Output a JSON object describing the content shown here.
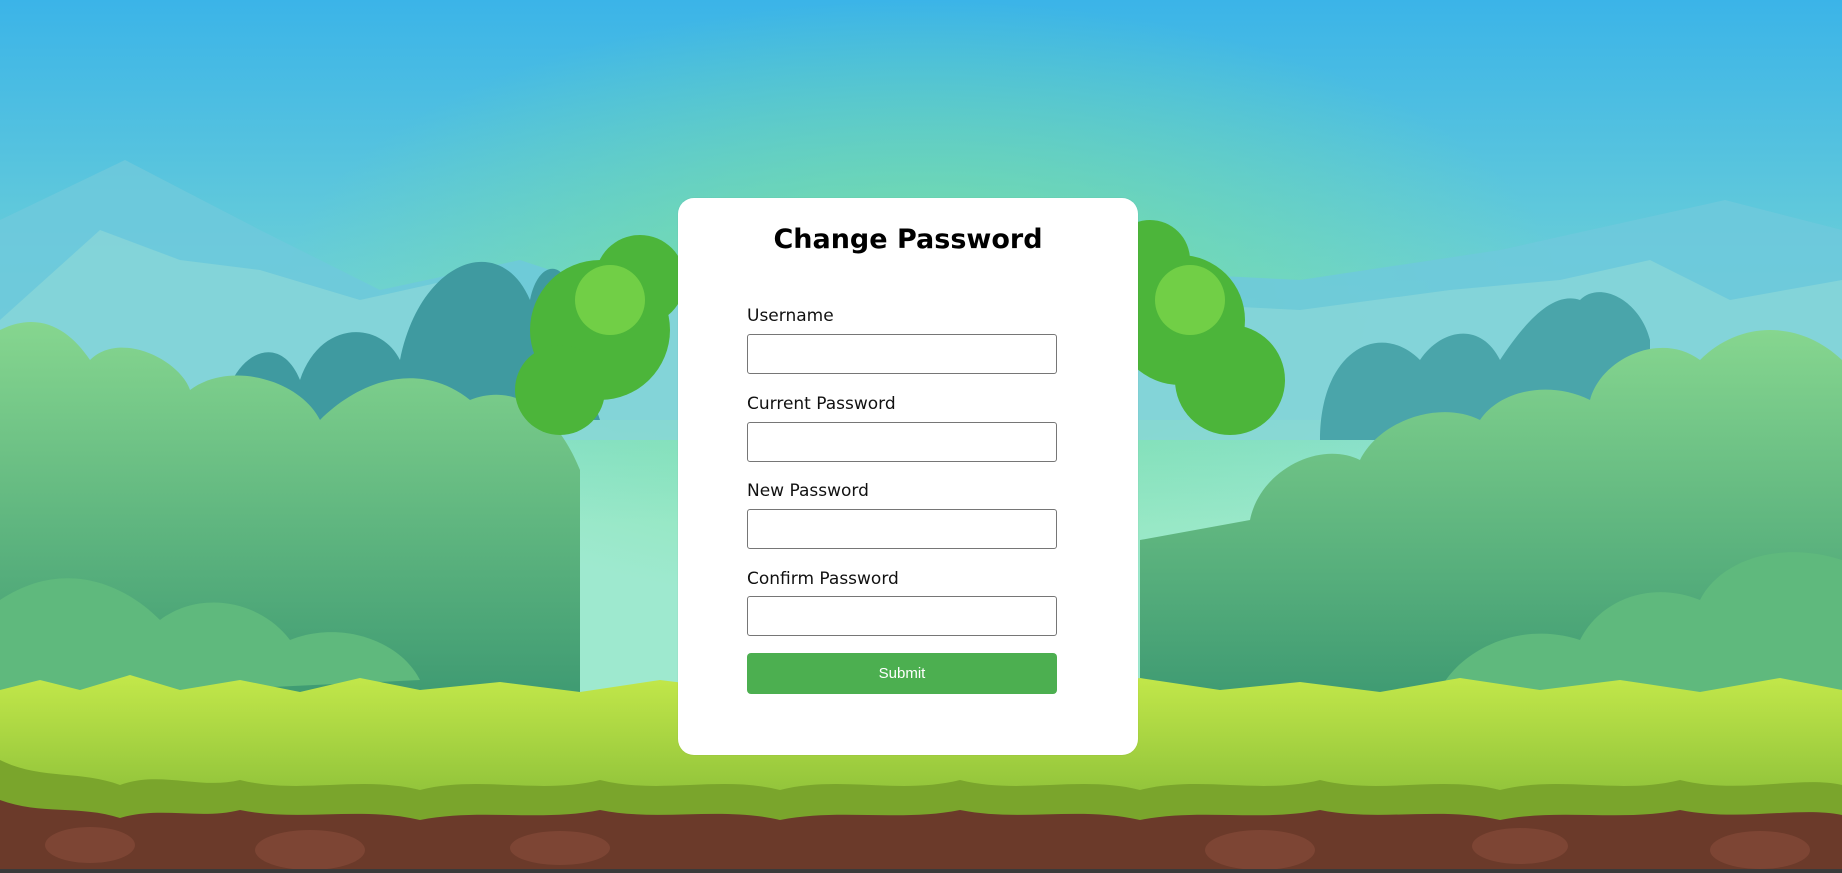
{
  "form": {
    "title": "Change Password",
    "fields": [
      {
        "label": "Username",
        "value": "",
        "type": "text"
      },
      {
        "label": "Current Password",
        "value": "",
        "type": "password"
      },
      {
        "label": "New Password",
        "value": "",
        "type": "password"
      },
      {
        "label": "Confirm Password",
        "value": "",
        "type": "password"
      }
    ],
    "submit_label": "Submit"
  },
  "colors": {
    "submit_button": "#4caf50",
    "card_background": "#ffffff",
    "sky_top": "#3bb4e8",
    "grass": "#b4e03c"
  }
}
